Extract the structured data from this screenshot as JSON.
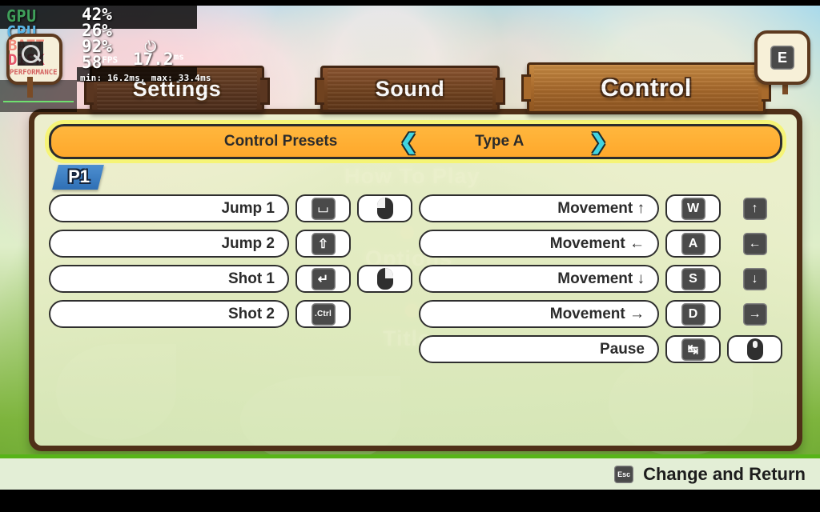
{
  "overlay": {
    "gpu_label": "GPU",
    "gpu_value": "42%",
    "cpu_label": "CPU",
    "cpu_value": "26%",
    "batt_label": "BATT",
    "batt_value": "92%",
    "disk_label": "DISK",
    "fps_value": "58",
    "fps_unit": "FPS",
    "frametime_value": "17.2",
    "frametime_unit": "ms",
    "minmax": "min: 16.2ms, max: 33.4ms",
    "watermark": "PERFORMANCE",
    "colors": {
      "gpu": "#3fa05a",
      "cpu": "#5ab6e8",
      "batt": "#f18a7a",
      "disk": "#e4566a"
    }
  },
  "topright": {
    "key_label": "E"
  },
  "tabs": [
    {
      "label": "Settings",
      "state": "inactive-dark"
    },
    {
      "label": "Sound",
      "state": "inactive"
    },
    {
      "label": "Control",
      "state": "active"
    }
  ],
  "presets": {
    "label": "Control Presets",
    "prev_arrow": "❮",
    "value": "Type A",
    "next_arrow": "❯",
    "accent": "#ffb03a",
    "arrow_color": "#41d4e0"
  },
  "player": {
    "badge": "P1"
  },
  "ghost_menu": [
    {
      "label": "How To Play"
    },
    {
      "label": "Options"
    },
    {
      "label": "Title"
    }
  ],
  "bindings": {
    "left_column": [
      {
        "action": "Jump 1",
        "key": "⌴",
        "key_kind": "space",
        "mouse": "left"
      },
      {
        "action": "Jump 2",
        "key": "⇧",
        "key_kind": "shift",
        "mouse": null
      },
      {
        "action": "Shot 1",
        "key": "↵",
        "key_kind": "enter",
        "mouse": "right"
      },
      {
        "action": "Shot 2",
        "key": ".Ctrl",
        "key_kind": "text",
        "mouse": null
      }
    ],
    "right_column": [
      {
        "action": "Movement ↑",
        "key": "W",
        "key_kind": "text",
        "alt_key": "↑"
      },
      {
        "action": "Movement ←",
        "key": "A",
        "key_kind": "text",
        "alt_key": "←"
      },
      {
        "action": "Movement ↓",
        "key": "S",
        "key_kind": "text",
        "alt_key": "↓"
      },
      {
        "action": "Movement →",
        "key": "D",
        "key_kind": "text",
        "alt_key": "→"
      },
      {
        "action": "Pause",
        "key": "↹",
        "key_kind": "tab",
        "mouse": "middle"
      }
    ]
  },
  "footer": {
    "key_label": "Esc",
    "label": "Change and Return"
  }
}
